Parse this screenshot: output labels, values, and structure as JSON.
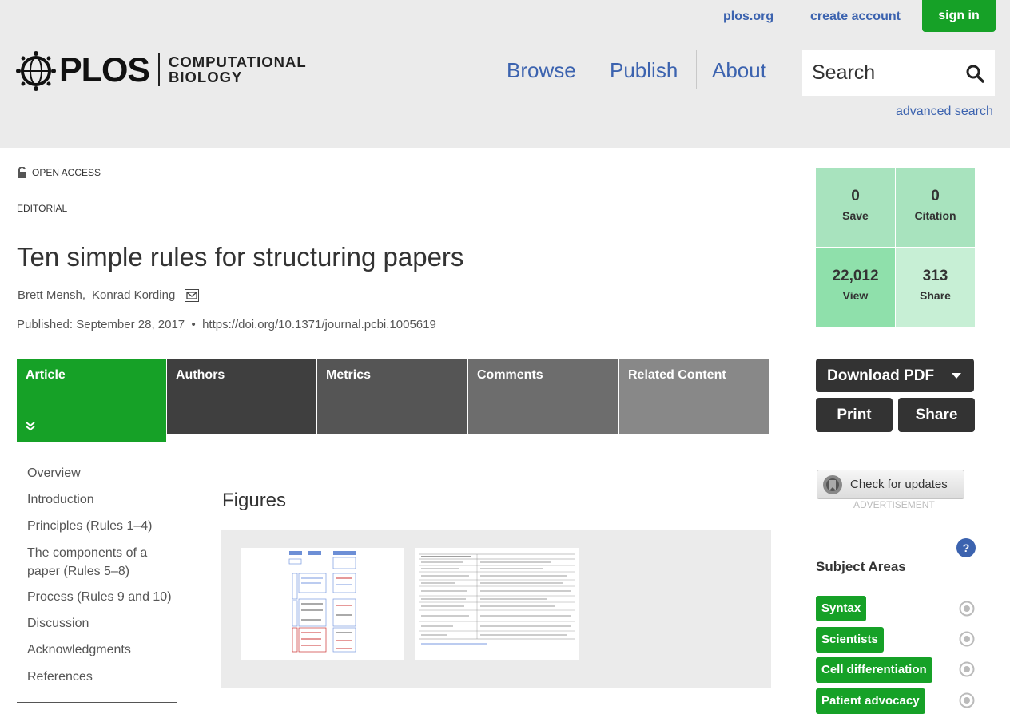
{
  "header": {
    "top_links": [
      "plos.org",
      "create account"
    ],
    "signin_label": "sign in",
    "logo_text": "PLOS",
    "journal_line1": "COMPUTATIONAL",
    "journal_line2": "BIOLOGY",
    "nav": [
      "Browse",
      "Publish",
      "About"
    ],
    "search_placeholder": "Search",
    "advanced_search": "advanced search"
  },
  "article": {
    "open_access": "OPEN ACCESS",
    "type": "EDITORIAL",
    "title": "Ten simple rules for structuring papers",
    "authors": [
      "Brett Mensh,",
      "Konrad Kording"
    ],
    "published": "Published: September 28, 2017",
    "doi": "https://doi.org/10.1371/journal.pcbi.1005619"
  },
  "tabs": [
    "Article",
    "Authors",
    "Metrics",
    "Comments",
    "Related Content"
  ],
  "toc": [
    "Overview",
    "Introduction",
    "Principles (Rules 1–4)",
    "The components of a paper (Rules 5–8)",
    "Process (Rules 9 and 10)",
    "Discussion",
    "Acknowledgments",
    "References"
  ],
  "figures": {
    "title": "Figures"
  },
  "metrics": {
    "save": {
      "value": "0",
      "label": "Save"
    },
    "citation": {
      "value": "0",
      "label": "Citation"
    },
    "view": {
      "value": "22,012",
      "label": "View"
    },
    "share": {
      "value": "313",
      "label": "Share"
    }
  },
  "actions": {
    "download_pdf": "Download PDF",
    "print": "Print",
    "share": "Share",
    "check_updates": "Check for updates",
    "advertisement": "ADVERTISEMENT"
  },
  "subject_areas": {
    "title": "Subject Areas",
    "help": "?",
    "items": [
      "Syntax",
      "Scientists",
      "Cell differentiation",
      "Patient advocacy"
    ]
  },
  "colors": {
    "brand_green": "#16a127",
    "link_blue": "#3c63af",
    "header_gray": "#ebebeb"
  }
}
